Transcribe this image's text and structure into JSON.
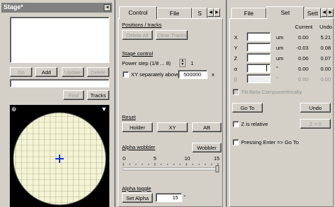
{
  "stage": {
    "title": "Stage*",
    "buttons": {
      "go": "Go",
      "add": "Add",
      "update": "Update",
      "delete": "Delete",
      "find": "Find",
      "tracks": "Tracks"
    }
  },
  "middle": {
    "tabs": [
      "Control",
      "File",
      "S"
    ],
    "positions_header": "Positions / tracks",
    "delete_all": "Delete All",
    "clear_tracks": "Clear Tracks",
    "stage_control_header": "Stage control",
    "power_step_label": "Power step (1/8 ... 8)",
    "power_step_value": "1",
    "xy_sep_label": "XY separately above",
    "xy_sep_value": "500000",
    "xy_sep_unit": "x",
    "reset_header": "Reset",
    "holder": "Holder",
    "xy": "XY",
    "ab": "AB",
    "alpha_wobbler_header": "Alpha wobbler",
    "wobbler": "Wobbler",
    "slider_ticks": [
      "0",
      "5",
      "10",
      "15"
    ],
    "alpha_toggle_header": "Alpha toggle",
    "set_alpha": "Set Alpha",
    "alpha_value": "15",
    "alpha_unit": "°"
  },
  "right": {
    "tabs": [
      "File",
      "Set",
      "Sett"
    ],
    "col_current": "Current",
    "col_undo": "Undo",
    "rows": [
      {
        "axis": "X",
        "unit": "um",
        "current": "0.00",
        "undo": "5.21",
        "disabled": false
      },
      {
        "axis": "Y",
        "unit": "um",
        "current": "-0.03",
        "undo": "0.08",
        "disabled": false
      },
      {
        "axis": "Z",
        "unit": "um",
        "current": "0.06",
        "undo": "0.07",
        "disabled": false
      },
      {
        "axis": "α",
        "unit": "°",
        "current": "0.00",
        "undo": "0.00",
        "disabled": false
      },
      {
        "axis": "β",
        "unit": "°",
        "current": "0.00",
        "undo": "0.00",
        "disabled": true
      }
    ],
    "tilt_beta": "Tilt Beta Compucentrically",
    "goto": "Go To",
    "undo": "Undo",
    "z_relative": "Z is relative",
    "z_zero": "Z = 0",
    "pressing_enter": "Pressing Enter => Go To"
  }
}
